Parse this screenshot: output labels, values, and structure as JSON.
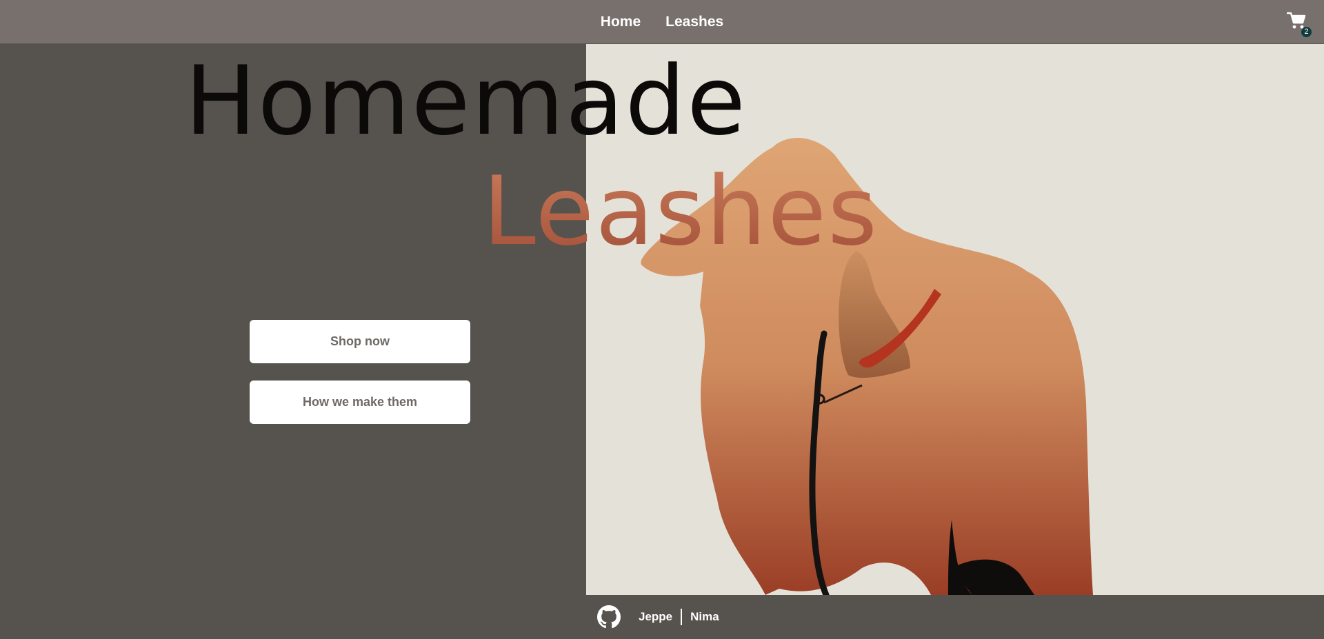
{
  "nav": {
    "links": [
      "Home",
      "Leashes"
    ],
    "cart_count": "2",
    "cart_icon": "shopping-cart-icon"
  },
  "hero": {
    "headline_line1": "Homemade",
    "headline_line2": "Leashes",
    "buttons": {
      "shop": "Shop now",
      "how": "How we make them"
    },
    "image": "illustrated-dog-with-red-leash"
  },
  "footer": {
    "github_icon": "github-icon",
    "authors": [
      "Jeppe",
      "Nima"
    ]
  },
  "colors": {
    "navbar": "#77706c",
    "background": "#56524e",
    "image_background": "#e4e2d8",
    "accent": "#b0603f",
    "button_text": "#6e6964"
  }
}
